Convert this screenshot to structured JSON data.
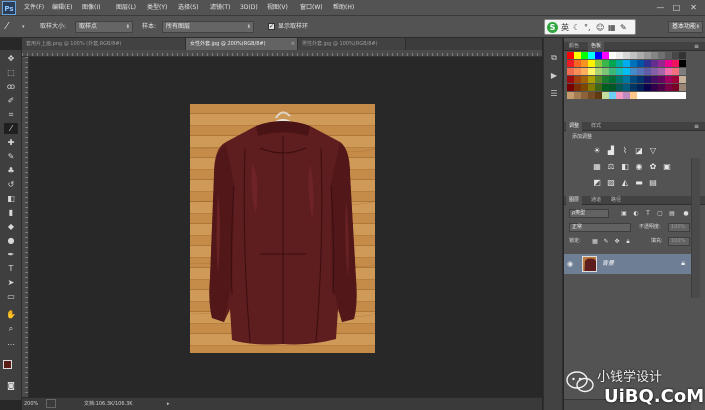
{
  "app": {
    "logo": "Ps"
  },
  "menu": [
    "文件(F)",
    "编辑(E)",
    "图像(I)",
    "图层(L)",
    "类型(Y)",
    "选择(S)",
    "滤镜(T)",
    "3D(D)",
    "视图(V)",
    "窗口(W)",
    "帮助(H)"
  ],
  "window_controls": {
    "minimize": "—",
    "maximize": "□",
    "close": "✕"
  },
  "options": {
    "brush_size_label": "取样大小:",
    "brush_size_value": "取样点",
    "sample_label": "样本:",
    "sample_value": "所有图层",
    "show_ring_label": "显示取样环",
    "show_ring_checked": true
  },
  "ime": {
    "logo": "S",
    "mode": "英"
  },
  "workspace": "基本功能",
  "tabs": [
    {
      "label": "套用片上画.png @ 100% (外套,RGB/8#)",
      "active": false
    },
    {
      "label": "女性外套.jpg @ 200%(RGB/8#)",
      "active": true
    },
    {
      "label": "男性外套.jpg @ 100%(RGB/8#)",
      "active": false
    }
  ],
  "status": {
    "zoom": "200%",
    "doc": "文档:106.3K/106.3K"
  },
  "panels": {
    "color_tabs": [
      "颜色",
      "色板"
    ],
    "adjust_tabs": [
      "调整",
      "样式"
    ],
    "adjust_title": "添加调整",
    "layers_tabs": [
      "图层",
      "通道",
      "路径"
    ],
    "layer_filter": "ρ类型",
    "blend_mode": "正常",
    "opacity_label": "不透明度:",
    "opacity_value": "100%",
    "lock_label": "锁定:",
    "fill_label": "填充:",
    "fill_value": "100%",
    "layer_name": "背景"
  },
  "watermark": {
    "cn": "小钱学设计",
    "url": "UiBQ.CoM"
  },
  "colors": {
    "foreground": "#5a1a16",
    "background": "#ffffff",
    "layer_selected": "#6e7e95"
  }
}
